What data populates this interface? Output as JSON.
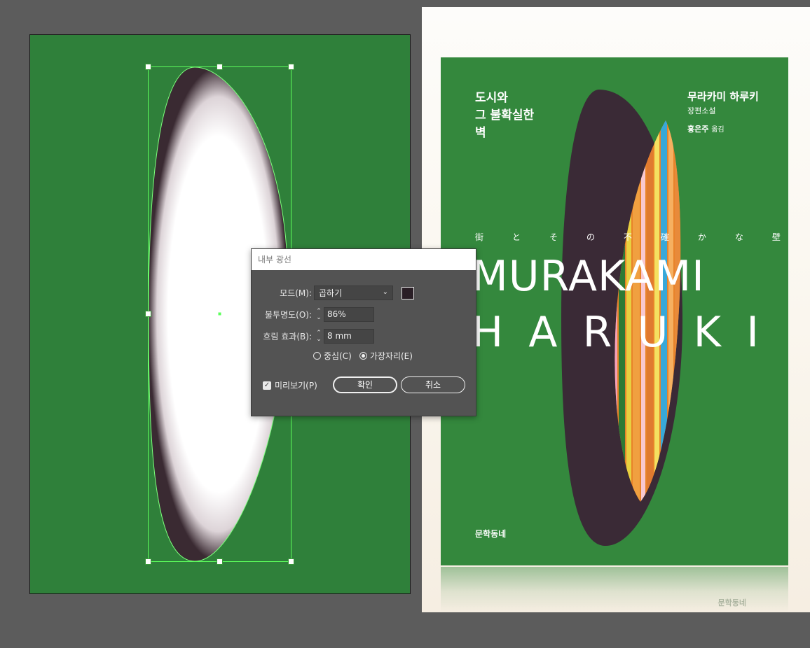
{
  "dialog": {
    "title": "내부 광선",
    "mode_label": "모드(M):",
    "mode_value": "곱하기",
    "swatch_color": "#2a1f26",
    "opacity_label": "불투명도(O):",
    "opacity_value": "86%",
    "blur_label": "흐림 효과(B):",
    "blur_value": "8 mm",
    "source_center_label": "중심(C)",
    "source_edge_label": "가장자리(E)",
    "source_selected": "edge",
    "preview_label": "미리보기(P)",
    "preview_checked": true,
    "ok_label": "확인",
    "cancel_label": "취소"
  },
  "artboard": {
    "background_color": "#2f803a",
    "selection_color": "#5cff5c",
    "shape": "ellipse with inner glow"
  },
  "cover": {
    "title_line1": "도시와",
    "title_line2": "그 불확실한",
    "title_line3": "벽",
    "author": "무라카미 하루키",
    "genre": "장편소설",
    "translator_name": "홍은주",
    "translator_role": "옮김",
    "japanese_chars": [
      "街",
      "と",
      "そ",
      "の",
      "不",
      "確",
      "か",
      "な",
      "壁"
    ],
    "name_line1": "MURAKAMI",
    "name_line2_letters": [
      "H",
      "A",
      "R",
      "U",
      "K",
      "I"
    ],
    "publisher": "문학동네",
    "reflection_publisher": "문학동네",
    "background_color": "#34883d"
  }
}
